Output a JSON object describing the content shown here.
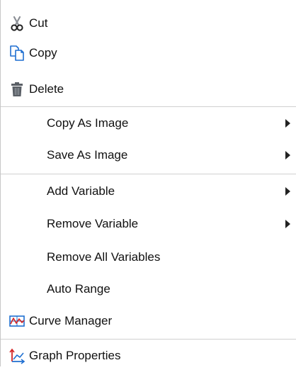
{
  "menu": {
    "items": [
      {
        "label": "Cut",
        "icon": "scissors-icon"
      },
      {
        "label": "Copy",
        "icon": "copy-icon"
      },
      {
        "label": "Delete",
        "icon": "trash-icon"
      },
      {
        "label": "Copy As Image",
        "submenu": true
      },
      {
        "label": "Save As Image",
        "submenu": true
      },
      {
        "label": "Add Variable",
        "submenu": true
      },
      {
        "label": "Remove Variable",
        "submenu": true
      },
      {
        "label": "Remove All Variables"
      },
      {
        "label": "Auto Range"
      },
      {
        "label": "Curve Manager",
        "icon": "curve-manager-icon"
      },
      {
        "label": "Graph Properties",
        "icon": "graph-properties-icon"
      }
    ]
  },
  "colors": {
    "separator": "#d0d0d0",
    "text": "#111111",
    "icon_blue": "#1f6fd1",
    "icon_red": "#d42424",
    "icon_gray": "#5a5f66"
  }
}
